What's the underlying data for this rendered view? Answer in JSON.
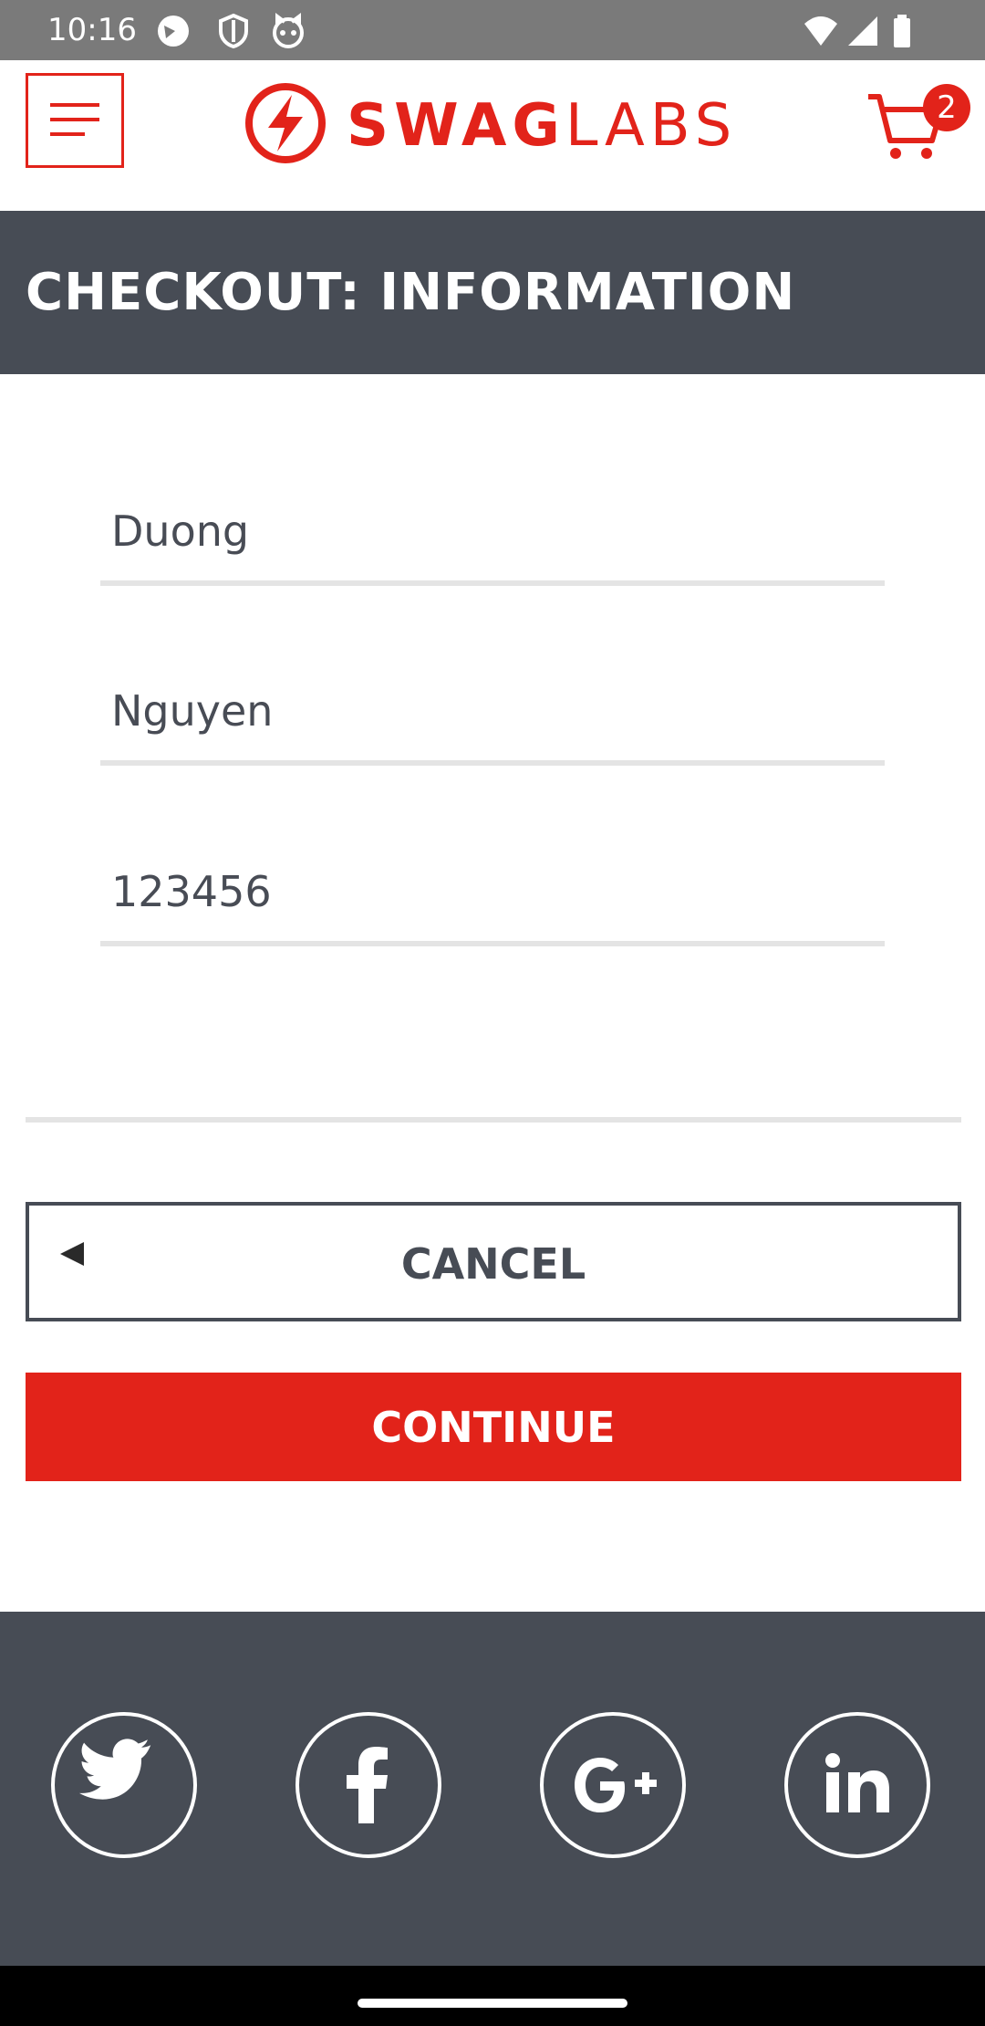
{
  "status_bar": {
    "time": "10:16",
    "left_icons": [
      "camera-app-icon",
      "shield-icon",
      "cat-icon"
    ],
    "right_icons": [
      "wifi-icon",
      "signal-icon",
      "battery-icon"
    ]
  },
  "header": {
    "menu_icon": "hamburger-menu-icon",
    "logo_bold": "SWAG",
    "logo_light": "LABS",
    "cart_icon": "shopping-cart-icon",
    "cart_count": "2"
  },
  "page": {
    "title": "CHECKOUT: INFORMATION"
  },
  "form": {
    "first_name": "Duong",
    "last_name": "Nguyen",
    "postal_code": "123456"
  },
  "buttons": {
    "cancel": "CANCEL",
    "continue": "CONTINUE"
  },
  "footer": {
    "social_icons": [
      "twitter-icon",
      "facebook-icon",
      "google-plus-icon",
      "linkedin-icon"
    ]
  },
  "colors": {
    "brand_red": "#e2231a",
    "dark_slate": "#474c55",
    "status_gray": "#7a7a7a"
  }
}
